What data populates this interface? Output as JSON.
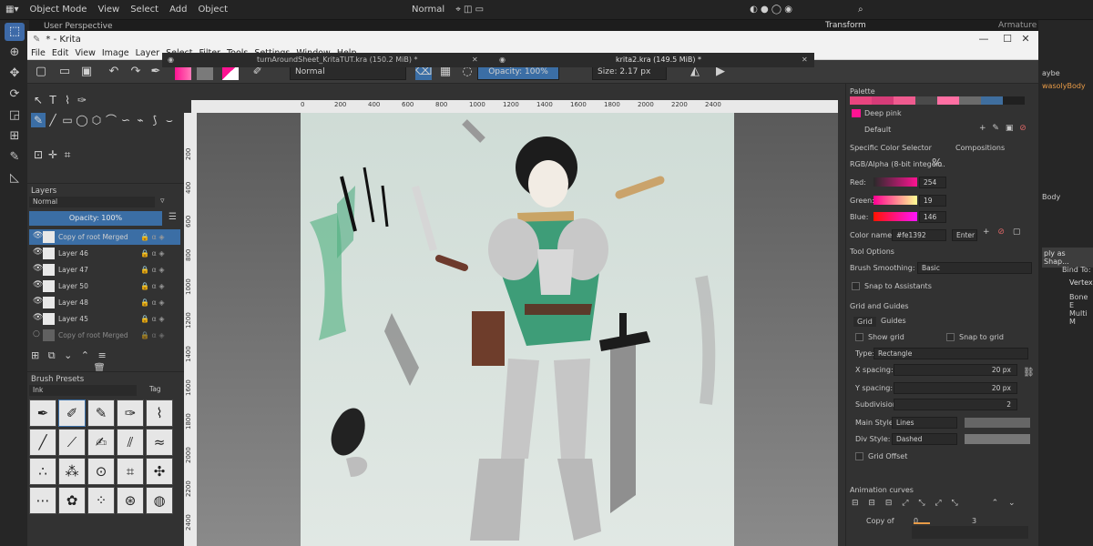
{
  "blender": {
    "mode": "Object Mode",
    "menu": [
      "View",
      "Select",
      "Add",
      "Object"
    ],
    "viewport_label": "User Perspective",
    "shading": "Normal",
    "transform_panel": "Transform",
    "armature_label": "Armature",
    "right_items": [
      "aybe",
      "wasolyBody",
      "Body",
      "ply as Shap...",
      "Bind To:",
      "Vertex",
      "Bone E",
      "Multi M"
    ]
  },
  "window": {
    "title": "* - Krita",
    "minimize": "—",
    "maximize": "☐",
    "close": "✕"
  },
  "menu": [
    "File",
    "Edit",
    "View",
    "Image",
    "Layer",
    "Select",
    "Filter",
    "Tools",
    "Settings",
    "Window",
    "Help"
  ],
  "toolbar": {
    "blend_mode": "Normal",
    "opacity": "Opacity: 100%",
    "size": "Size: 2.17 px"
  },
  "tabs": [
    {
      "name": "turnAroundSheet_KritaTUT.kra (150.2 MiB) *",
      "close": "✕"
    },
    {
      "name": "krita2.kra (149.5 MiB) *",
      "close": "✕"
    }
  ],
  "ruler": {
    "top": [
      "0",
      "200",
      "400",
      "600",
      "800",
      "1000",
      "1200",
      "1400",
      "1600",
      "1800",
      "2000",
      "2200",
      "2400"
    ],
    "left": [
      "200",
      "400",
      "600",
      "800",
      "1000",
      "1200",
      "1400",
      "1600",
      "1800",
      "2000",
      "2200",
      "2400"
    ]
  },
  "layers": {
    "title": "Layers",
    "blend": "Normal",
    "opacity": "Opacity: 100%",
    "items": [
      {
        "name": "Copy of root Merged",
        "selected": true
      },
      {
        "name": "Layer 46",
        "selected": false
      },
      {
        "name": "Layer 47",
        "selected": false
      },
      {
        "name": "Layer 50",
        "selected": false
      },
      {
        "name": "Layer 48",
        "selected": false
      },
      {
        "name": "Layer 45",
        "selected": false
      },
      {
        "name": "Copy of root Merged",
        "selected": false
      }
    ]
  },
  "brush_presets": {
    "title": "Brush Presets",
    "filter": "Ink",
    "tag": "Tag"
  },
  "palette": {
    "title": "Palette",
    "color_name": "Deep pink",
    "palette_name": "Default",
    "swatches": [
      "#e8457f",
      "#d63c78",
      "#ef5b8f",
      "#4a4a4a",
      "#ff6fa3",
      "#6b6b6b",
      "#3f6e9e",
      "#202020"
    ]
  },
  "color_selector": {
    "title": "Specific Color Selector",
    "compositions": "Compositions",
    "model": "RGB/Alpha (8-bit integer...",
    "percent": "%",
    "red_label": "Red:",
    "red": "254",
    "green_label": "Green:",
    "green": "19",
    "blue_label": "Blue:",
    "blue": "146",
    "color_name_label": "Color name:",
    "color_hex": "#fe1392",
    "enter": "Enter"
  },
  "tool_options": {
    "title": "Tool Options",
    "smoothing_label": "Brush Smoothing:",
    "smoothing": "Basic",
    "snap_assistants": "Snap to Assistants"
  },
  "grid": {
    "title": "Grid and Guides",
    "tab_grid": "Grid",
    "tab_guides": "Guides",
    "show_grid": "Show grid",
    "snap_grid": "Snap to grid",
    "type_label": "Type:",
    "type": "Rectangle",
    "xspacing_label": "X spacing:",
    "xspacing": "20 px",
    "yspacing_label": "Y spacing:",
    "yspacing": "20 px",
    "subdivision_label": "Subdivision:",
    "subdivision": "2",
    "main_style_label": "Main Style:",
    "main_style": "Lines",
    "div_style_label": "Div Style:",
    "div_style": "Dashed",
    "offset": "Grid Offset"
  },
  "animation": {
    "title": "Animation curves",
    "row": "Copy of",
    "frame0": "0",
    "frame3": "3"
  },
  "accent": "#3b6ea5",
  "fg_color": "#fe1392"
}
